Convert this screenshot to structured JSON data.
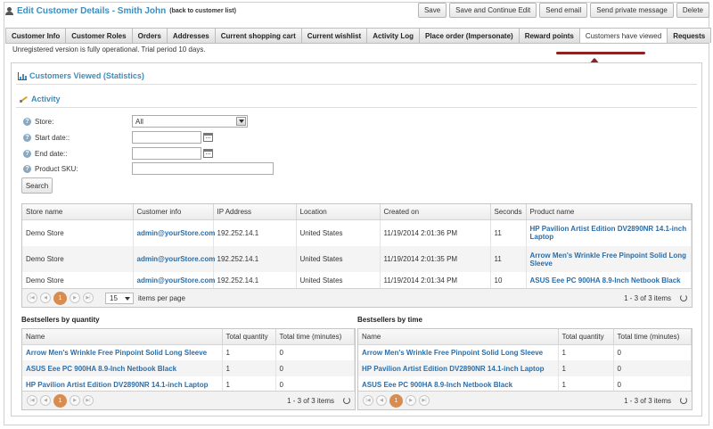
{
  "header": {
    "title": "Edit Customer Details - Smith John",
    "back_link": "(back to customer list)",
    "buttons": [
      "Save",
      "Save and Continue Edit",
      "Send email",
      "Send private message",
      "Delete"
    ]
  },
  "tabs": [
    {
      "label": "Customer Info",
      "active": false
    },
    {
      "label": "Customer Roles",
      "active": false
    },
    {
      "label": "Orders",
      "active": false
    },
    {
      "label": "Addresses",
      "active": false
    },
    {
      "label": "Current shopping cart",
      "active": false
    },
    {
      "label": "Current wishlist",
      "active": false
    },
    {
      "label": "Activity Log",
      "active": false
    },
    {
      "label": "Place order (Impersonate)",
      "active": false
    },
    {
      "label": "Reward points",
      "active": false
    },
    {
      "label": "Customers have viewed",
      "active": true
    },
    {
      "label": "Requests",
      "active": false
    }
  ],
  "notice": "Unregistered version is fully operational. Trial period 10 days.",
  "section_title": "Customers Viewed (Statistics)",
  "activity": {
    "title": "Activity",
    "labels": {
      "store": "Store:",
      "start_date": "Start date::",
      "end_date": "End date::",
      "sku": "Product SKU:"
    },
    "store_value": "All",
    "start_date_value": "",
    "end_date_value": "",
    "sku_value": "",
    "search_label": "Search"
  },
  "viewed_grid": {
    "columns": [
      "Store name",
      "Customer info",
      "IP Address",
      "Location",
      "Created on",
      "Seconds",
      "Product name"
    ],
    "rows": [
      [
        "Demo Store",
        "admin@yourStore.com",
        "192.252.14.1",
        "United States",
        "11/19/2014 2:01:36 PM",
        "11",
        "HP Pavilion Artist Edition DV2890NR 14.1-inch Laptop"
      ],
      [
        "Demo Store",
        "admin@yourStore.com",
        "192.252.14.1",
        "United States",
        "11/19/2014 2:01:35 PM",
        "11",
        "Arrow Men's Wrinkle Free Pinpoint Solid Long Sleeve"
      ],
      [
        "Demo Store",
        "admin@yourStore.com",
        "192.252.14.1",
        "United States",
        "11/19/2014 2:01:34 PM",
        "10",
        "ASUS Eee PC 900HA 8.9-Inch Netbook Black"
      ]
    ],
    "page": "1",
    "page_size": "15",
    "per_page_label": "items per page",
    "info": "1 - 3 of 3 items"
  },
  "best_qty": {
    "title": "Bestsellers by quantity",
    "columns": [
      "Name",
      "Total quantity",
      "Total time (minutes)"
    ],
    "rows": [
      [
        "Arrow Men's Wrinkle Free Pinpoint Solid Long Sleeve",
        "1",
        "0"
      ],
      [
        "ASUS Eee PC 900HA 8.9-Inch Netbook Black",
        "1",
        "0"
      ],
      [
        "HP Pavilion Artist Edition DV2890NR 14.1-inch Laptop",
        "1",
        "0"
      ]
    ],
    "page": "1",
    "info": "1 - 3 of 3 items"
  },
  "best_time": {
    "title": "Bestsellers by time",
    "columns": [
      "Name",
      "Total quantity",
      "Total time (minutes)"
    ],
    "rows": [
      [
        "Arrow Men's Wrinkle Free Pinpoint Solid Long Sleeve",
        "1",
        "0"
      ],
      [
        "HP Pavilion Artist Edition DV2890NR 14.1-inch Laptop",
        "1",
        "0"
      ],
      [
        "ASUS Eee PC 900HA 8.9-Inch Netbook Black",
        "1",
        "0"
      ]
    ],
    "page": "1",
    "info": "1 - 3 of 3 items"
  },
  "icons": {
    "header": "person-icon",
    "section": "chart-icon",
    "activity": "activity-icon",
    "help": "help-icon",
    "calendar": "calendar-icon",
    "refresh": "refresh-icon",
    "annotation": "arrow-up-icon"
  },
  "colors": {
    "accent": "#3c8dbc",
    "link": "#2b6ea8",
    "current_page": "#d98c4f",
    "annotation": "#8b2323"
  }
}
